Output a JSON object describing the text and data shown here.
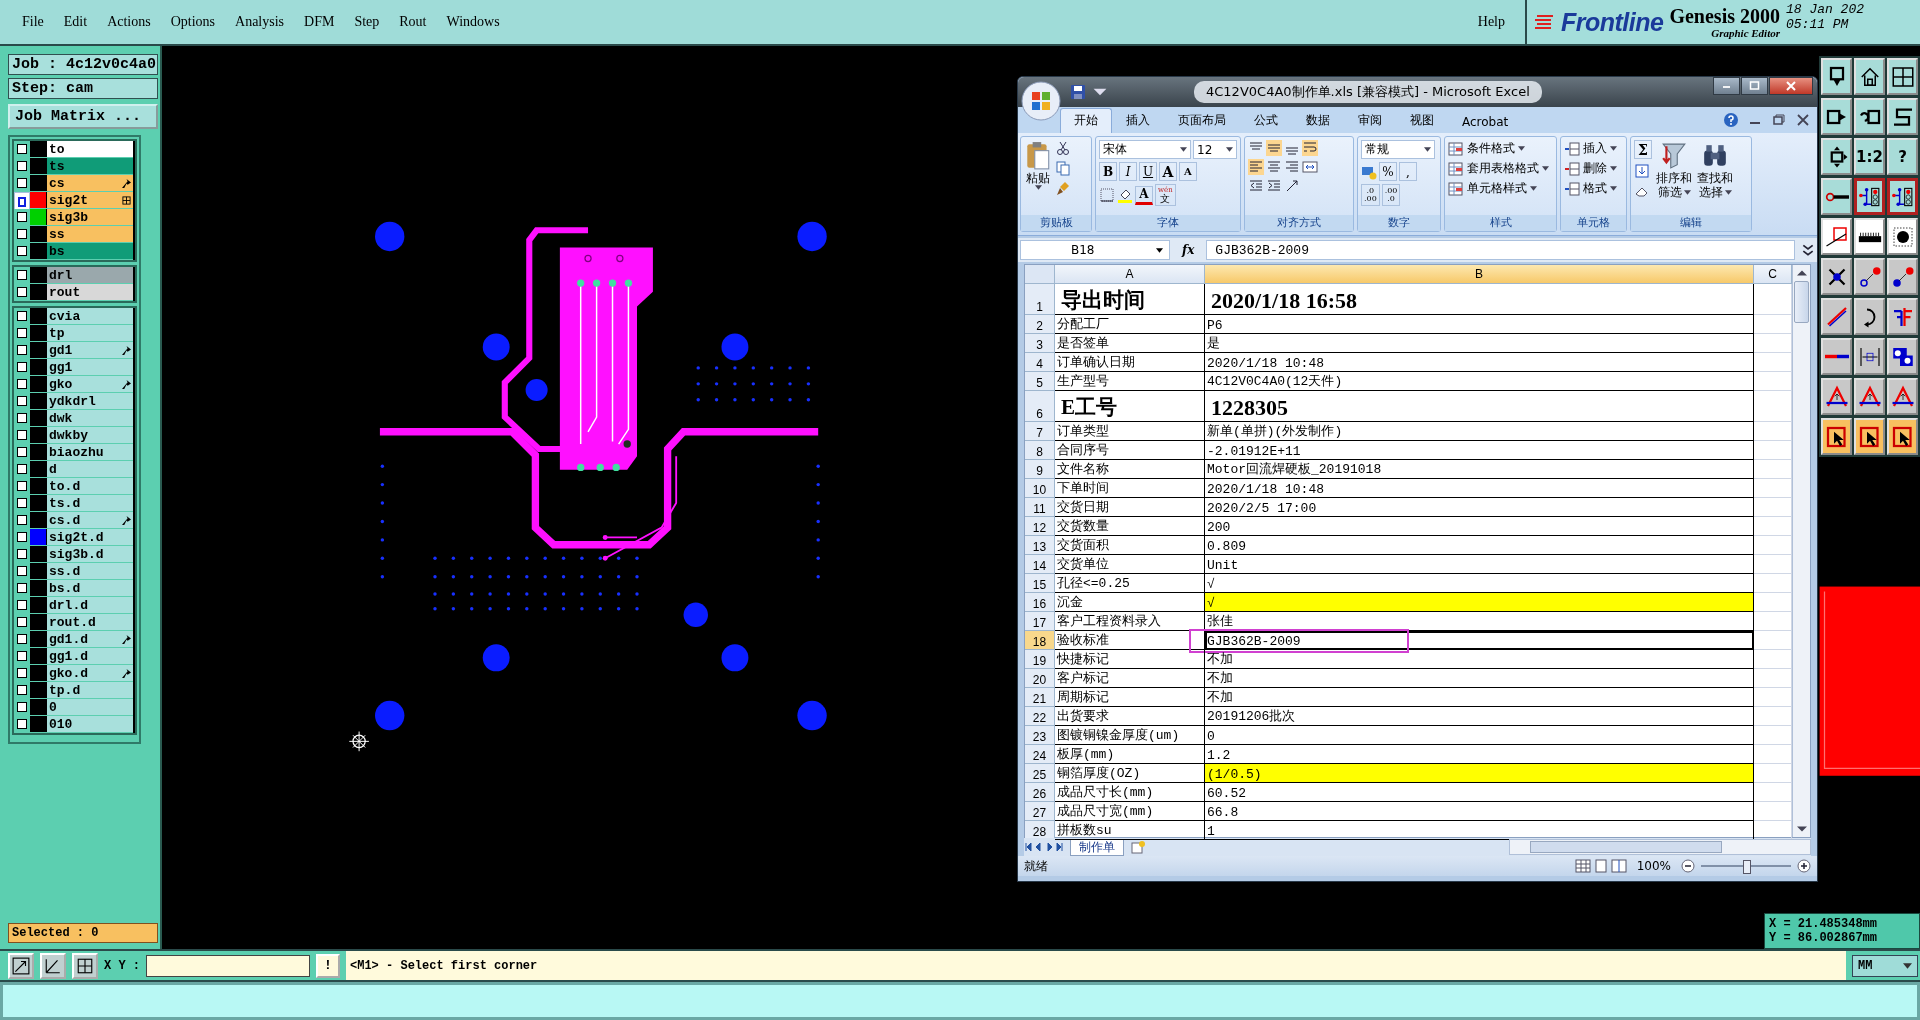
{
  "menu_bar": {
    "items": [
      "File",
      "Edit",
      "Actions",
      "Options",
      "Analysis",
      "DFM",
      "Step",
      "Rout",
      "Windows"
    ],
    "help": "Help"
  },
  "brand": {
    "logo": "Frontline",
    "product": "Genesis 2000",
    "subtitle": "Graphic Editor",
    "date": "18 Jan 202",
    "time": "05:11 PM"
  },
  "job_panel": {
    "job": "Job : 4c12v0c4a0",
    "step": "Step: cam",
    "matrix_button": "Job Matrix ...",
    "selected_count": "Selected : 0"
  },
  "layer_groups": [
    {
      "layers": [
        {
          "name": "to",
          "kind": "outline",
          "affected": false,
          "active": false,
          "selected": false
        },
        {
          "name": "ts",
          "kind": "mask",
          "affected": false,
          "active": false,
          "selected": false
        },
        {
          "name": "cs",
          "kind": "layer",
          "affected": true,
          "active": false,
          "selected": false
        },
        {
          "name": "sig2t",
          "kind": "layer",
          "color": "#ff0000",
          "affected": false,
          "active": true,
          "selected": true
        },
        {
          "name": "sig3b",
          "kind": "layer",
          "color": "#00d000",
          "affected": false,
          "active": false,
          "selected": false
        },
        {
          "name": "ss",
          "kind": "layer",
          "affected": false,
          "active": false,
          "selected": false
        },
        {
          "name": "bs",
          "kind": "mask",
          "affected": false,
          "active": false,
          "selected": false
        }
      ]
    },
    {
      "layers": [
        {
          "name": "drl",
          "kind": "drill",
          "affected": false,
          "active": false,
          "selected": false
        },
        {
          "name": "rout",
          "kind": "rout",
          "affected": false,
          "active": false,
          "selected": false
        }
      ]
    },
    {
      "layers": [
        {
          "name": "cvia",
          "kind": "misc",
          "affected": false,
          "active": false,
          "selected": false
        },
        {
          "name": "tp",
          "kind": "misc",
          "affected": false,
          "active": false,
          "selected": false
        },
        {
          "name": "gd1",
          "kind": "misc",
          "affected": true,
          "active": false,
          "selected": false
        },
        {
          "name": "gg1",
          "kind": "misc",
          "affected": false,
          "active": false,
          "selected": false
        },
        {
          "name": "gko",
          "kind": "misc",
          "affected": true,
          "active": false,
          "selected": false
        },
        {
          "name": "ydkdrl",
          "kind": "misc",
          "affected": false,
          "active": false,
          "selected": false
        },
        {
          "name": "dwk",
          "kind": "misc",
          "affected": false,
          "active": false,
          "selected": false
        },
        {
          "name": "dwkby",
          "kind": "misc",
          "affected": false,
          "active": false,
          "selected": false
        },
        {
          "name": "biaozhu",
          "kind": "misc",
          "affected": false,
          "active": false,
          "selected": false
        },
        {
          "name": "d",
          "kind": "misc",
          "affected": false,
          "active": false,
          "selected": false
        },
        {
          "name": "to.d",
          "kind": "misc",
          "affected": false,
          "active": false,
          "selected": false
        },
        {
          "name": "ts.d",
          "kind": "misc",
          "affected": false,
          "active": false,
          "selected": false
        },
        {
          "name": "cs.d",
          "kind": "misc",
          "affected": true,
          "active": false,
          "selected": false
        },
        {
          "name": "sig2t.d",
          "kind": "misc",
          "color": "#0000ff",
          "affected": false,
          "active": false,
          "selected": false
        },
        {
          "name": "sig3b.d",
          "kind": "misc",
          "affected": false,
          "active": false,
          "selected": false
        },
        {
          "name": "ss.d",
          "kind": "misc",
          "affected": false,
          "active": false,
          "selected": false
        },
        {
          "name": "bs.d",
          "kind": "misc",
          "affected": false,
          "active": false,
          "selected": false
        },
        {
          "name": "drl.d",
          "kind": "misc",
          "affected": false,
          "active": false,
          "selected": false
        },
        {
          "name": "rout.d",
          "kind": "misc",
          "affected": false,
          "active": false,
          "selected": false
        },
        {
          "name": "gd1.d",
          "kind": "misc",
          "affected": true,
          "active": false,
          "selected": false
        },
        {
          "name": "gg1.d",
          "kind": "misc",
          "affected": false,
          "active": false,
          "selected": false
        },
        {
          "name": "gko.d",
          "kind": "misc",
          "affected": true,
          "active": false,
          "selected": false
        },
        {
          "name": "tp.d",
          "kind": "misc",
          "affected": false,
          "active": false,
          "selected": false
        },
        {
          "name": "0",
          "kind": "misc",
          "affected": false,
          "active": false,
          "selected": false
        },
        {
          "name": "010",
          "kind": "misc",
          "affected": false,
          "active": false,
          "selected": false
        }
      ]
    }
  ],
  "toolbar": {
    "buttons": [
      {
        "kind": "icon"
      },
      {
        "kind": "icon"
      },
      {
        "kind": "icon"
      },
      {
        "kind": "icon"
      },
      {
        "kind": "icon"
      },
      {
        "kind": "icon"
      },
      {
        "kind": "icon"
      },
      {
        "kind": "text",
        "label": "1:2"
      },
      {
        "kind": "text",
        "label": "?"
      },
      {
        "kind": "icon"
      },
      {
        "kind": "icon"
      },
      {
        "kind": "icon"
      },
      {
        "kind": "icon"
      },
      {
        "kind": "icon"
      },
      {
        "kind": "icon"
      },
      {
        "kind": "icon"
      },
      {
        "kind": "icon"
      },
      {
        "kind": "icon"
      },
      {
        "kind": "icon"
      },
      {
        "kind": "icon"
      },
      {
        "kind": "icon"
      },
      {
        "kind": "icon"
      },
      {
        "kind": "icon"
      },
      {
        "kind": "icon"
      },
      {
        "kind": "icon"
      },
      {
        "kind": "icon"
      },
      {
        "kind": "icon"
      },
      {
        "kind": "icon"
      },
      {
        "kind": "icon"
      },
      {
        "kind": "icon"
      }
    ]
  },
  "coordinates": {
    "x": "X = 21.485348mm",
    "y": "Y = 86.002867mm"
  },
  "command_bar": {
    "label": "X Y :",
    "bang": "!",
    "message": "<M1> - Select first corner",
    "units": "MM"
  },
  "excel": {
    "title": "4C12V0C4A0制作单.xls  [兼容模式] - Microsoft Excel",
    "tabs": [
      {
        "label": "开始",
        "selected": true
      },
      {
        "label": "插入",
        "selected": false
      },
      {
        "label": "页面布局",
        "selected": false
      },
      {
        "label": "公式",
        "selected": false
      },
      {
        "label": "数据",
        "selected": false
      },
      {
        "label": "审阅",
        "selected": false
      },
      {
        "label": "视图",
        "selected": false
      },
      {
        "label": "Acrobat",
        "selected": false
      }
    ],
    "ribbon": {
      "groups": [
        "剪贴板",
        "字体",
        "对齐方式",
        "数字",
        "样式",
        "单元格",
        "编辑"
      ],
      "paste": "粘贴",
      "font": "宋体",
      "size": "12",
      "format_buttons": [
        "B",
        "I",
        "U"
      ],
      "size_buttons": [
        "A",
        "A"
      ],
      "font_color": "A",
      "phonetic_top": "wén",
      "phonetic": "文",
      "number_format": "常规",
      "percent": "%",
      "comma": ",",
      "decimals": [
        {
          "top": ".0",
          "bottom": ".00"
        },
        {
          "top": ".00",
          "bottom": ".0"
        }
      ],
      "styles": [
        "条件格式",
        "套用表格格式",
        "单元格样式"
      ],
      "cells": [
        "插入",
        "删除",
        "格式"
      ],
      "sum": "Σ",
      "sort": [
        "排序和",
        "筛选"
      ],
      "find": [
        "查找和",
        "选择"
      ]
    },
    "name_box": "B18",
    "formula_label": "fx",
    "formula": "GJB362B-2009",
    "columns": [
      "A",
      "B",
      "C"
    ],
    "rows": [
      {
        "num": "1",
        "label": "导出时间",
        "value": "2020/1/18 16:58",
        "kind": "large",
        "highlight": false,
        "selected": false
      },
      {
        "num": "2",
        "label": "分配工厂",
        "value": "P6",
        "kind": "normal",
        "highlight": false,
        "selected": false
      },
      {
        "num": "3",
        "label": "是否签单",
        "value": "是",
        "kind": "normal",
        "highlight": false,
        "selected": false
      },
      {
        "num": "4",
        "label": "订单确认日期",
        "value": "2020/1/18 10:48",
        "kind": "normal",
        "highlight": false,
        "selected": false
      },
      {
        "num": "5",
        "label": "生产型号",
        "value": "4C12V0C4A0(12天件)",
        "kind": "normal",
        "highlight": false,
        "selected": false
      },
      {
        "num": "6",
        "label": "E工号",
        "value": "1228305",
        "kind": "large",
        "highlight": false,
        "selected": false
      },
      {
        "num": "7",
        "label": "订单类型",
        "value": "新单(单拼)(外发制作)",
        "kind": "normal",
        "highlight": false,
        "selected": false
      },
      {
        "num": "8",
        "label": "合同序号",
        "value": "-2.01912E+11",
        "kind": "normal",
        "highlight": false,
        "selected": false
      },
      {
        "num": "9",
        "label": "文件名称",
        "value": "Motor回流焊硬板_20191018",
        "kind": "normal",
        "highlight": false,
        "selected": false
      },
      {
        "num": "10",
        "label": "下单时间",
        "value": "2020/1/18 10:48",
        "kind": "normal",
        "highlight": false,
        "selected": false
      },
      {
        "num": "11",
        "label": "交货日期",
        "value": "2020/2/5 17:00",
        "kind": "normal",
        "highlight": false,
        "selected": false
      },
      {
        "num": "12",
        "label": "交货数量",
        "value": "200",
        "kind": "normal",
        "highlight": false,
        "selected": false
      },
      {
        "num": "13",
        "label": "交货面积",
        "value": "0.809",
        "kind": "normal",
        "highlight": false,
        "selected": false
      },
      {
        "num": "14",
        "label": "交货单位",
        "value": "Unit",
        "kind": "normal",
        "highlight": false,
        "selected": false
      },
      {
        "num": "15",
        "label": "孔径<=0.25",
        "value": "√",
        "kind": "normal",
        "highlight": false,
        "selected": false
      },
      {
        "num": "16",
        "label": "沉金",
        "value": "√",
        "kind": "normal",
        "highlight": true,
        "selected": false
      },
      {
        "num": "17",
        "label": "客户工程资料录入",
        "value": "张佳",
        "kind": "normal",
        "highlight": false,
        "selected": false
      },
      {
        "num": "18",
        "label": "验收标准",
        "value": "GJB362B-2009",
        "kind": "normal",
        "highlight": false,
        "selected": true
      },
      {
        "num": "19",
        "label": "快捷标记",
        "value": "不加",
        "kind": "normal",
        "highlight": false,
        "selected": false
      },
      {
        "num": "20",
        "label": "客户标记",
        "value": "不加",
        "kind": "normal",
        "highlight": false,
        "selected": false
      },
      {
        "num": "21",
        "label": "周期标记",
        "value": "不加",
        "kind": "normal",
        "highlight": false,
        "selected": false
      },
      {
        "num": "22",
        "label": "出货要求",
        "value": "20191206批次",
        "kind": "normal",
        "highlight": false,
        "selected": false
      },
      {
        "num": "23",
        "label": "图镀铜镍金厚度(um)",
        "value": "0",
        "kind": "normal",
        "highlight": false,
        "selected": false
      },
      {
        "num": "24",
        "label": "板厚(mm)",
        "value": "1.2",
        "kind": "normal",
        "highlight": false,
        "selected": false
      },
      {
        "num": "25",
        "label": "铜箔厚度(OZ)",
        "value": " (1/0.5)",
        "kind": "normal",
        "highlight": true,
        "selected": false
      },
      {
        "num": "26",
        "label": "成品尺寸长(mm)",
        "value": "60.52",
        "kind": "normal",
        "highlight": false,
        "selected": false
      },
      {
        "num": "27",
        "label": "成品尺寸宽(mm)",
        "value": "66.8",
        "kind": "normal",
        "highlight": false,
        "selected": false
      },
      {
        "num": "28",
        "label": "拼板数su",
        "value": "1",
        "kind": "normal",
        "highlight": false,
        "selected": false
      }
    ],
    "sheet_tabs": [
      {
        "label": "制作单",
        "selected": true
      }
    ],
    "status": "就绪",
    "zoom": "100%",
    "zoom_slider": {
      "level": 0.5
    }
  }
}
